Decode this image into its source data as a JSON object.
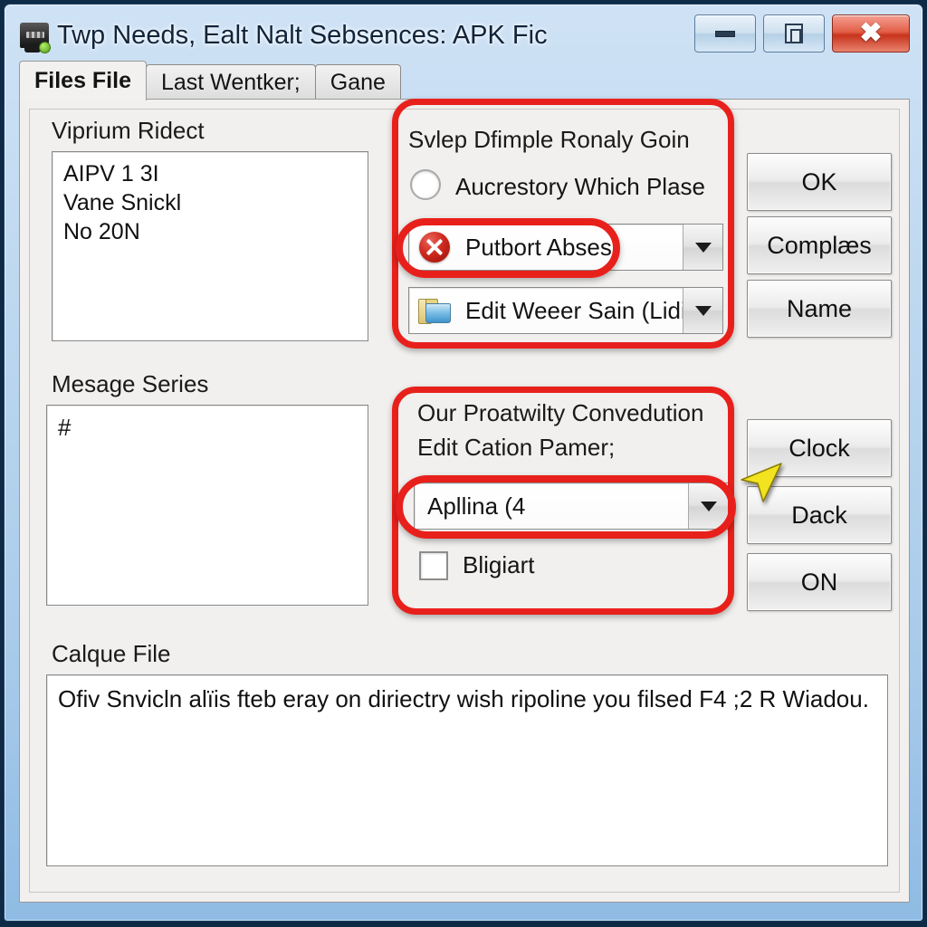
{
  "window": {
    "title": "Twp Needs, Ealt Nalt Sebsences: APK Fic",
    "icon_name": "app-icon",
    "controls": {
      "minimize_label": "–",
      "maximize_label": "",
      "close_label": "✖"
    },
    "colors": {
      "frame": "#a9cbea",
      "client": "#f1f0ee",
      "close_button": "#c8331c",
      "highlight": "#e8201b",
      "cursor": "#f2e320"
    }
  },
  "tabs": [
    {
      "label": "Files File",
      "active": true
    },
    {
      "label": "Last Wentker;",
      "active": false
    },
    {
      "label": "Gane",
      "active": false
    }
  ],
  "left_panel": {
    "label": "Viprium Ridect",
    "items": [
      "AIPV 1 3I",
      "Vane Snickl",
      "No 20N"
    ]
  },
  "options_group": {
    "heading": "Svlep Dfimple Ronaly Goin",
    "radio": {
      "label": "Aucrestory Which Plase",
      "checked": false
    },
    "combo_x": {
      "value": "Putbort Abses",
      "icon": "x-circle-icon",
      "arrow": "chevron-down-icon"
    },
    "combo_folder": {
      "value": "Edit Weeer Sain (Lidir?",
      "icon": "folder-icon",
      "arrow": "chevron-down-icon"
    }
  },
  "message_panel": {
    "label": "Mesage Series",
    "content": "#"
  },
  "convention_group": {
    "line1": "Our Proatwilty Convedution",
    "line2": "Edit Cation Pamer;",
    "combo": {
      "value": "Apllina (4",
      "arrow": "chevron-down-icon"
    },
    "checkbox": {
      "label": "Bligiart",
      "checked": false
    }
  },
  "buttons_top": [
    {
      "label": "OK"
    },
    {
      "label": "Complæs"
    },
    {
      "label": "Name"
    }
  ],
  "buttons_bottom": [
    {
      "label": "Clock"
    },
    {
      "label": "Dack"
    },
    {
      "label": "ON"
    }
  ],
  "bottom_panel": {
    "label": "Calque File",
    "text": "Ofiv Snvicln alïis fteb eray on diriectry wish ripoline you filsed F4 ;2 R Wiadou."
  }
}
